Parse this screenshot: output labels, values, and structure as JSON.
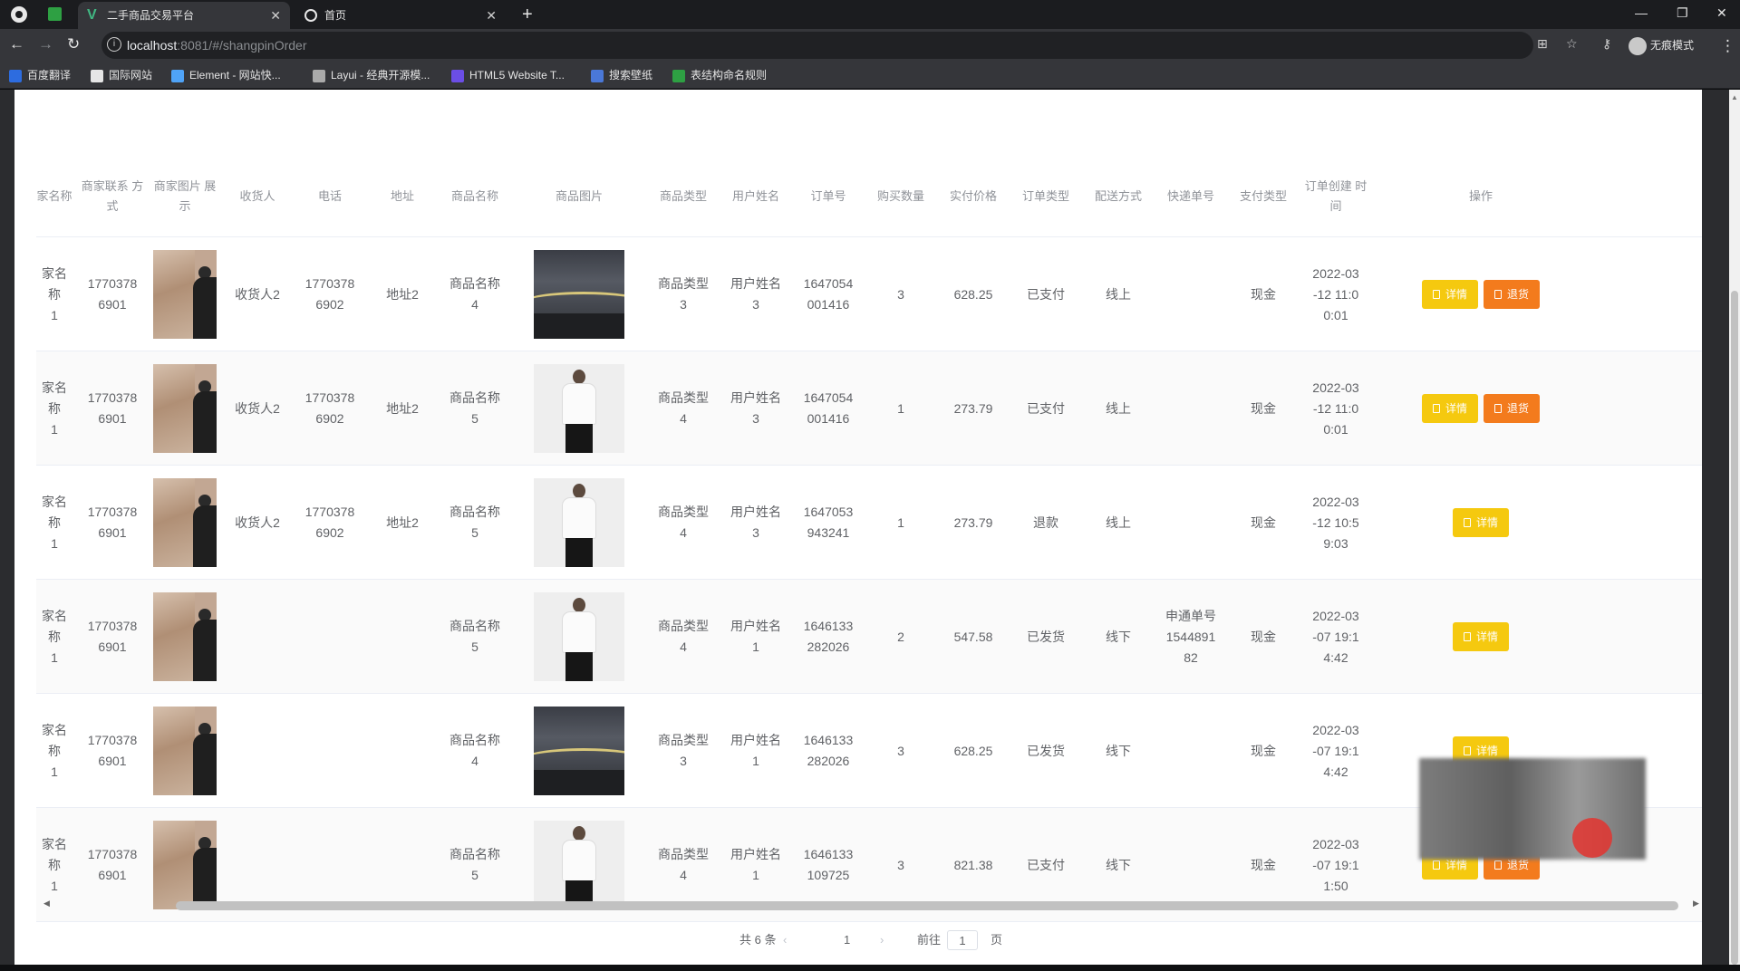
{
  "browser": {
    "tabs": [
      {
        "title": "二手商品交易平台",
        "active": true
      },
      {
        "title": "首页",
        "active": false
      }
    ],
    "url_host": "localhost",
    "url_path": ":8081/#/shangpinOrder",
    "profile_label": "无痕模式",
    "window_controls": [
      "—",
      "❐",
      "✕"
    ],
    "bookmarks": [
      {
        "label": "百度翻译",
        "color": "#2d6cdf"
      },
      {
        "label": "国际网站",
        "color": "#e6e6e6"
      },
      {
        "label": "Element - 网站快...",
        "color": "#4fa3f7"
      },
      {
        "label": "Layui - 经典开源模...",
        "color": "#aaaaaa"
      },
      {
        "label": "HTML5 Website T...",
        "color": "#6b4ee6"
      },
      {
        "label": "搜索壁纸",
        "color": "#4a78d8"
      },
      {
        "label": "表结构命名规则",
        "color": "#2ea043"
      }
    ]
  },
  "table": {
    "headers": [
      "家名称",
      "商家联系\n方式",
      "商家图片\n展示",
      "收货人",
      "电话",
      "地址",
      "商品名称",
      "商品图片",
      "商品类型",
      "用户姓名",
      "订单号",
      "购买数量",
      "实付价格",
      "订单类型",
      "配送方式",
      "快递单号",
      "支付类型",
      "订单创建\n时间",
      "操作"
    ],
    "rows": [
      {
        "shop": "家名称\n1",
        "contact": "1770378\n6901",
        "receiver": "收货人2",
        "phone": "1770378\n6902",
        "address": "地址2",
        "goods": "商品名称\n4",
        "img": "plate",
        "type": "商品类型\n3",
        "user": "用户姓名\n3",
        "order_no": "1647054\n001416",
        "qty": "3",
        "price": "628.25",
        "status": "已支付",
        "delivery": "线上",
        "express": "",
        "pay": "现金",
        "created": "2022-03\n-12 11:0\n0:01",
        "buttons": [
          "详情",
          "退货"
        ]
      },
      {
        "shop": "家名称\n1",
        "contact": "1770378\n6901",
        "receiver": "收货人2",
        "phone": "1770378\n6902",
        "address": "地址2",
        "goods": "商品名称\n5",
        "img": "shirt",
        "type": "商品类型\n4",
        "user": "用户姓名\n3",
        "order_no": "1647054\n001416",
        "qty": "1",
        "price": "273.79",
        "status": "已支付",
        "delivery": "线上",
        "express": "",
        "pay": "现金",
        "created": "2022-03\n-12 11:0\n0:01",
        "buttons": [
          "详情",
          "退货"
        ]
      },
      {
        "shop": "家名称\n1",
        "contact": "1770378\n6901",
        "receiver": "收货人2",
        "phone": "1770378\n6902",
        "address": "地址2",
        "goods": "商品名称\n5",
        "img": "shirt",
        "type": "商品类型\n4",
        "user": "用户姓名\n3",
        "order_no": "1647053\n943241",
        "qty": "1",
        "price": "273.79",
        "status": "退款",
        "delivery": "线上",
        "express": "",
        "pay": "现金",
        "created": "2022-03\n-12 10:5\n9:03",
        "buttons": [
          "详情"
        ]
      },
      {
        "shop": "家名称\n1",
        "contact": "1770378\n6901",
        "receiver": "",
        "phone": "",
        "address": "",
        "goods": "商品名称\n5",
        "img": "shirt",
        "type": "商品类型\n4",
        "user": "用户姓名\n1",
        "order_no": "1646133\n282026",
        "qty": "2",
        "price": "547.58",
        "status": "已发货",
        "delivery": "线下",
        "express": "申通单号\n1544891\n82",
        "pay": "现金",
        "created": "2022-03\n-07 19:1\n4:42",
        "buttons": [
          "详情"
        ]
      },
      {
        "shop": "家名称\n1",
        "contact": "1770378\n6901",
        "receiver": "",
        "phone": "",
        "address": "",
        "goods": "商品名称\n4",
        "img": "plate",
        "type": "商品类型\n3",
        "user": "用户姓名\n1",
        "order_no": "1646133\n282026",
        "qty": "3",
        "price": "628.25",
        "status": "已发货",
        "delivery": "线下",
        "express": "",
        "pay": "现金",
        "created": "2022-03\n-07 19:1\n4:42",
        "buttons": [
          "详情"
        ]
      },
      {
        "shop": "家名称\n1",
        "contact": "1770378\n6901",
        "receiver": "",
        "phone": "",
        "address": "",
        "goods": "商品名称\n5",
        "img": "shirt",
        "type": "商品类型\n4",
        "user": "用户姓名\n1",
        "order_no": "1646133\n109725",
        "qty": "3",
        "price": "821.38",
        "status": "已支付",
        "delivery": "线下",
        "express": "",
        "pay": "现金",
        "created": "2022-03\n-07 19:1\n1:50",
        "buttons": [
          "详情",
          "退货"
        ]
      }
    ]
  },
  "pagination": {
    "total": "共 6 条",
    "current_page": "1",
    "goto_label": "前往",
    "goto_value": "1",
    "page_suffix": "页"
  },
  "colors": {
    "detail_button": "#f5c90f",
    "refund_button": "#f37b1d",
    "header_text": "#909399",
    "cell_text": "#606266"
  }
}
